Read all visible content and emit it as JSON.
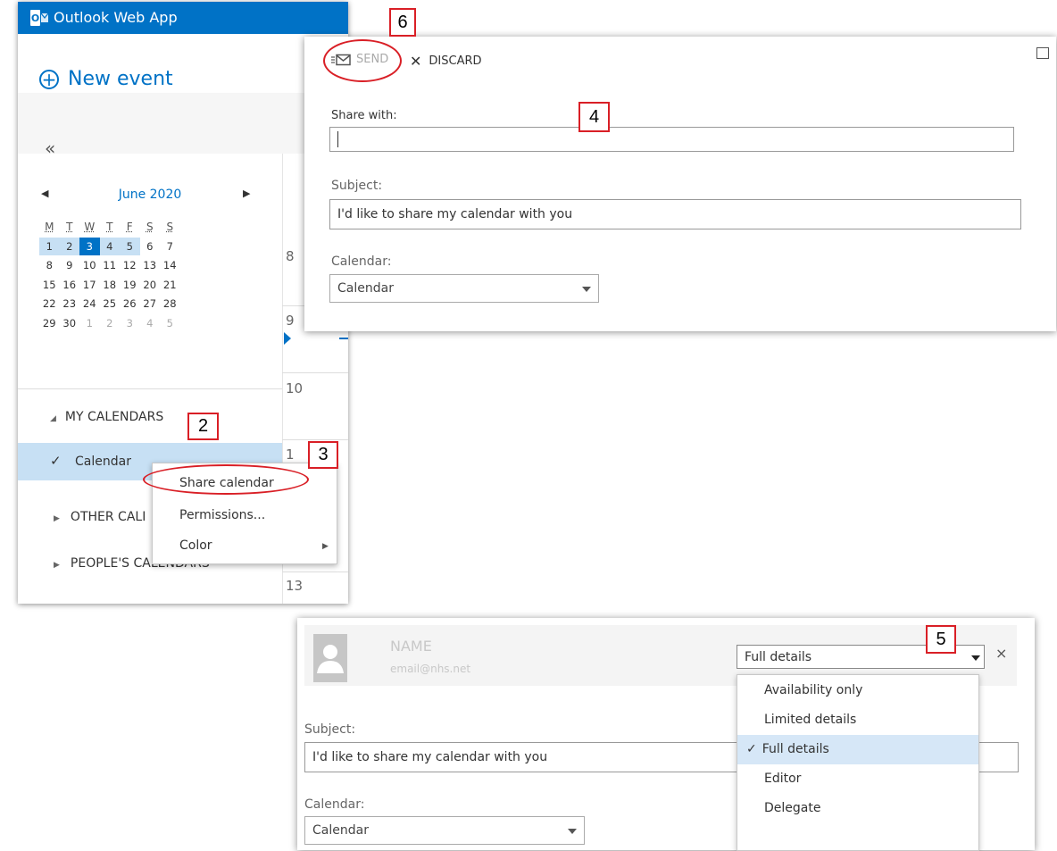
{
  "app": {
    "title": "Outlook Web App",
    "logo": "O"
  },
  "sidebar": {
    "new_event": "New event",
    "collapse": "«",
    "month": "June 2020",
    "weekdays": [
      "M",
      "T",
      "W",
      "T",
      "F",
      "S",
      "S"
    ],
    "weeks": [
      [
        "1",
        "2",
        "3",
        "4",
        "5",
        "6",
        "7"
      ],
      [
        "8",
        "9",
        "10",
        "11",
        "12",
        "13",
        "14"
      ],
      [
        "15",
        "16",
        "17",
        "18",
        "19",
        "20",
        "21"
      ],
      [
        "22",
        "23",
        "24",
        "25",
        "26",
        "27",
        "28"
      ],
      [
        "29",
        "30",
        "1",
        "2",
        "3",
        "4",
        "5"
      ]
    ],
    "my_calendars": "MY CALENDARS",
    "calendar_item": "Calendar",
    "other_calendars": "OTHER CALI",
    "peoples_calendars": "PEOPLE'S CALENDARS"
  },
  "timeline": {
    "hours": [
      "8",
      "9",
      "10",
      "1",
      "13"
    ]
  },
  "context_menu": {
    "items": [
      "Share calendar",
      "Permissions...",
      "Color"
    ]
  },
  "share_dialog": {
    "send": "SEND",
    "discard": "DISCARD",
    "share_with_label": "Share with:",
    "share_with_value": "",
    "subject_label": "Subject:",
    "subject_value": "I'd like to share my calendar with you",
    "calendar_label": "Calendar:",
    "calendar_value": "Calendar"
  },
  "permission_dialog": {
    "name": "NAME",
    "email": "email@nhs.net",
    "level": "Full details",
    "options": [
      "Availability only",
      "Limited details",
      "Full details",
      "Editor",
      "Delegate"
    ],
    "subject_label": "Subject:",
    "subject_value": "I'd like to share my calendar with you",
    "calendar_label": "Calendar:",
    "calendar_value": "Calendar",
    "close": "×"
  },
  "annotations": {
    "step2": "2",
    "step3": "3",
    "step4": "4",
    "step5": "5",
    "step6": "6"
  },
  "colors": {
    "brand": "#0072c6",
    "selection": "#c7e0f4",
    "annotation": "#d91f26"
  }
}
